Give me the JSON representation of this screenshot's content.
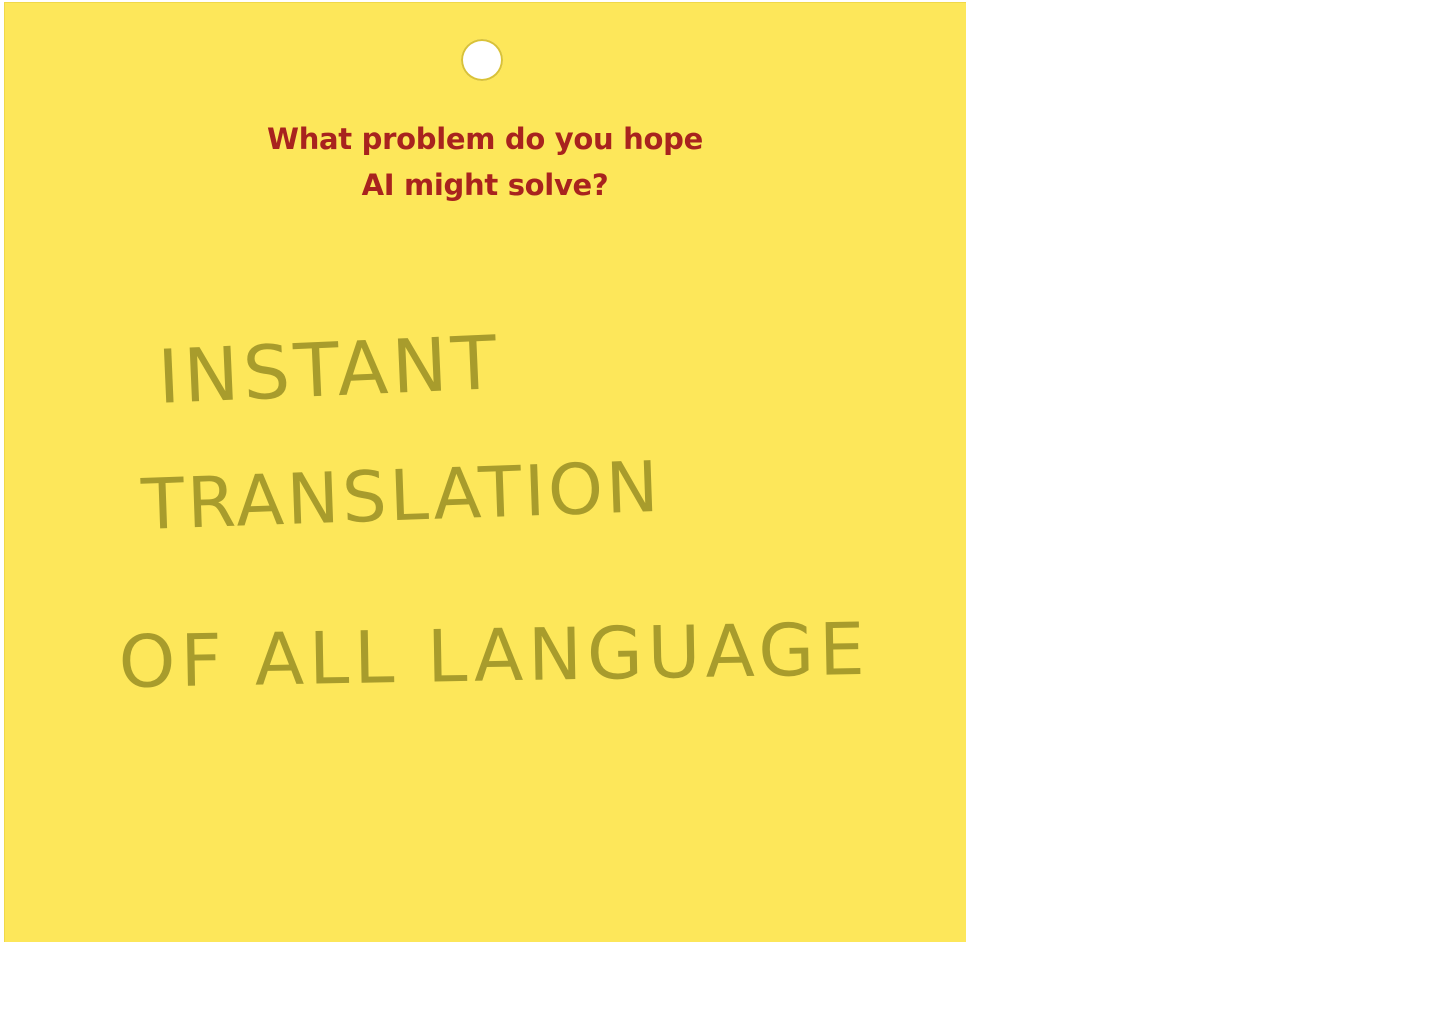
{
  "card": {
    "color": "#fde75a",
    "question": {
      "line1": "What problem do you hope",
      "line2": "AI might solve?",
      "color": "#a8231e"
    },
    "answer": {
      "line1": "INSTANT",
      "line2": "TRANSLATION",
      "line3": "OF ALL LANGUAGE",
      "ink_color": "#a89c2c"
    }
  }
}
